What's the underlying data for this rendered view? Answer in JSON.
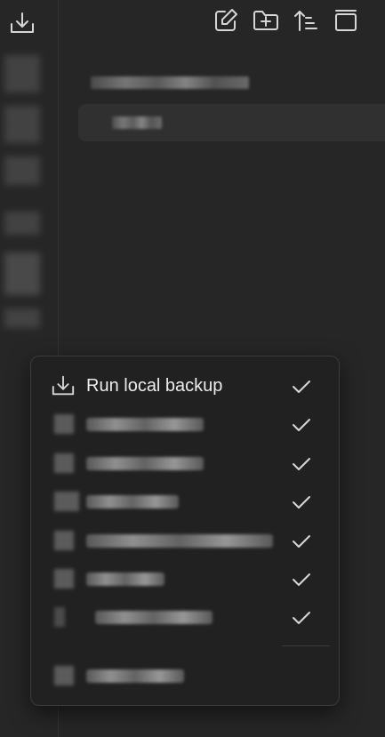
{
  "toolbar": {
    "icons": [
      "new-note-icon",
      "new-folder-icon",
      "sort-icon",
      "collapse-icon"
    ]
  },
  "ribbon": {
    "backup_icon": "download-icon"
  },
  "context_menu": {
    "items": [
      {
        "label": "Run local backup",
        "icon": "download-icon",
        "checked": true
      },
      {
        "label": "",
        "icon": "redacted-icon",
        "checked": true
      },
      {
        "label": "",
        "icon": "redacted-icon",
        "checked": true
      },
      {
        "label": "",
        "icon": "redacted-icon",
        "checked": true
      },
      {
        "label": "",
        "icon": "redacted-icon",
        "checked": true
      },
      {
        "label": "",
        "icon": "redacted-icon",
        "checked": true
      },
      {
        "label": "",
        "icon": "redacted-icon",
        "checked": true
      },
      {
        "label": "",
        "icon": "redacted-icon",
        "checked": false
      }
    ]
  },
  "colors": {
    "background": "#262626",
    "menu_background": "#212121",
    "text": "#ececec",
    "border": "#3c3c3c"
  }
}
